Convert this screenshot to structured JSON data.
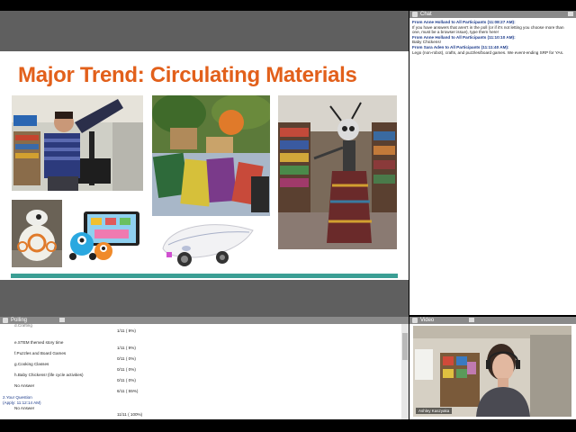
{
  "slide": {
    "title": "Major Trend: Circulating Materials"
  },
  "chat": {
    "panel_title": "Chat",
    "messages": [
      {
        "from": "From Anne Holland to All Participants (11:08:27 AM):",
        "text": "If you have answers that aren't in the poll (or if it's not letting you choose more than one, must be a browser issue), type them here!"
      },
      {
        "from": "From Anne Holland to All Participants (11:10:10 AM):",
        "text": "Baby Chickens!"
      },
      {
        "from": "From Sara Aden to All Participants (11:11:40 AM):",
        "text": "Lego (non-robot), crafts, and puzzles/board games. We event-ending SRP for YAs."
      }
    ]
  },
  "polling": {
    "panel_title": "Polling",
    "rows": [
      {
        "label": "e.STEM themed story time",
        "result": "1/11 (  9%)",
        "fraction": 0.09
      },
      {
        "label": "f.Puzzles and Board Games",
        "result": "0/11 (  0%)",
        "fraction": 0
      },
      {
        "label": "g.Cooking Classes",
        "result": "0/11 (  0%)",
        "fraction": 0
      },
      {
        "label": "h.Baby Chickens! (life cycle activities)",
        "result": "0/11 (  0%)",
        "fraction": 0
      },
      {
        "label": "No Answer",
        "result": "6/11 (  55%)",
        "fraction": 0.55
      }
    ],
    "question_label": "2.Your Question",
    "question_sub": "(Apply: 11:12:14 AM)",
    "no_answer_label": "No Answer",
    "total_result": "11/11 (  100%)",
    "top_result": "1/11 (  9%)",
    "top_label": "d.Crafting"
  },
  "video": {
    "panel_title": "Video",
    "participant_name": "Ashley Kaszyaka"
  },
  "colors": {
    "title_orange": "#e2601b",
    "teal": "#3a9e94",
    "panel_header": "#8a8a8a"
  }
}
